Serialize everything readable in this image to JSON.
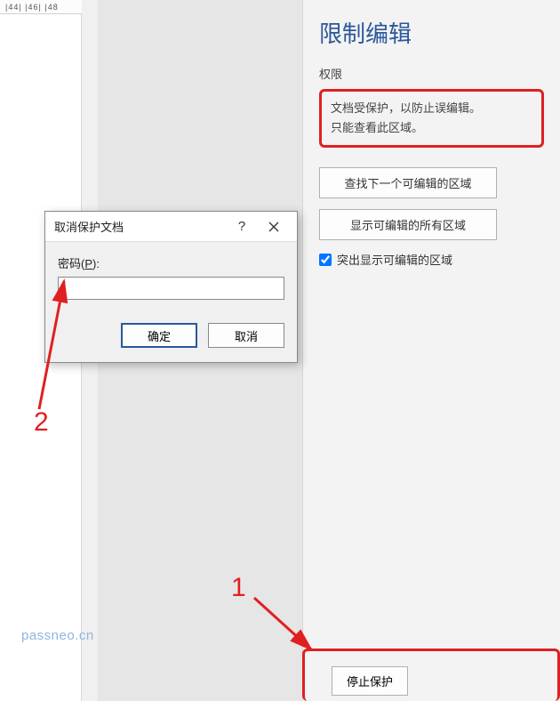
{
  "ruler": {
    "marks": "|44|  |46|  |48"
  },
  "panel": {
    "title": "限制编辑",
    "permission_label": "权限",
    "info_line1": "文档受保护，以防止误编辑。",
    "info_line2": "只能查看此区域。",
    "find_next_btn": "查找下一个可编辑的区域",
    "show_all_btn": "显示可编辑的所有区域",
    "highlight_check": "突出显示可编辑的区域",
    "stop_protect_btn": "停止保护"
  },
  "dialog": {
    "title": "取消保护文档",
    "help": "?",
    "password_label_pre": "密码(",
    "password_label_key": "P",
    "password_label_post": "):",
    "password_value": "",
    "ok_label": "确定",
    "cancel_label": "取消"
  },
  "annotations": {
    "num1": "1",
    "num2": "2"
  },
  "watermark": "passneo.cn"
}
